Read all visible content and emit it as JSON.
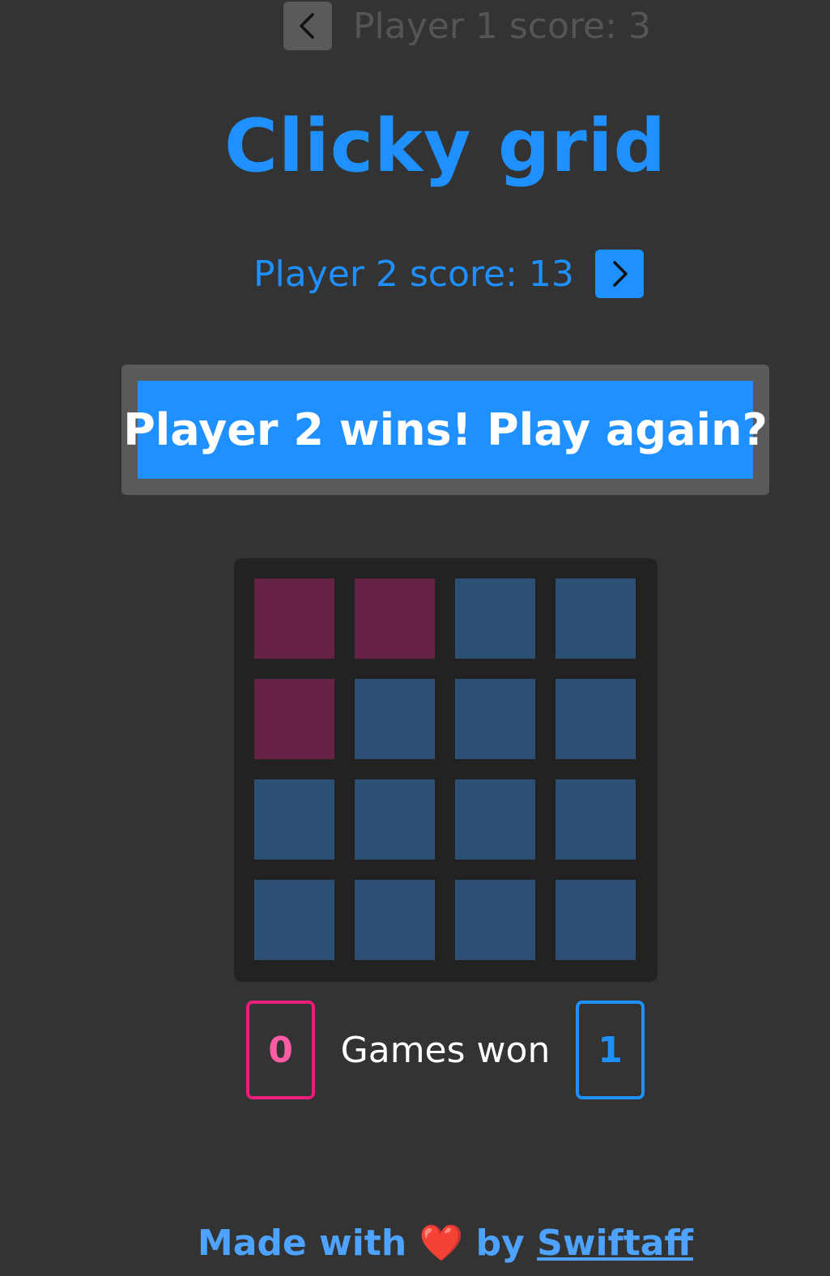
{
  "player1": {
    "score_label": "Player 1 score: 3",
    "nav_icon": "chevron-left-icon",
    "color": "#ff5ca8"
  },
  "title": "Clicky grid",
  "player2": {
    "score_label": "Player 2 score: 13",
    "nav_icon": "chevron-right-icon",
    "color": "#1e90ff"
  },
  "play_again_label": "Player 2 wins! Play again?",
  "grid": {
    "rows": 4,
    "cols": 4,
    "cells": [
      [
        "p1",
        "p1",
        "p2",
        "p2"
      ],
      [
        "p1",
        "p2",
        "p2",
        "p2"
      ],
      [
        "p2",
        "p2",
        "p2",
        "p2"
      ],
      [
        "p2",
        "p2",
        "p2",
        "p2"
      ]
    ],
    "colors": {
      "p1": "#662244",
      "p2": "#2c4f73"
    }
  },
  "games_won": {
    "label": "Games won",
    "player1": "0",
    "player2": "1"
  },
  "footer": {
    "prefix": "Made with",
    "heart": "❤️",
    "by": "by",
    "author": "Swiftaff"
  }
}
